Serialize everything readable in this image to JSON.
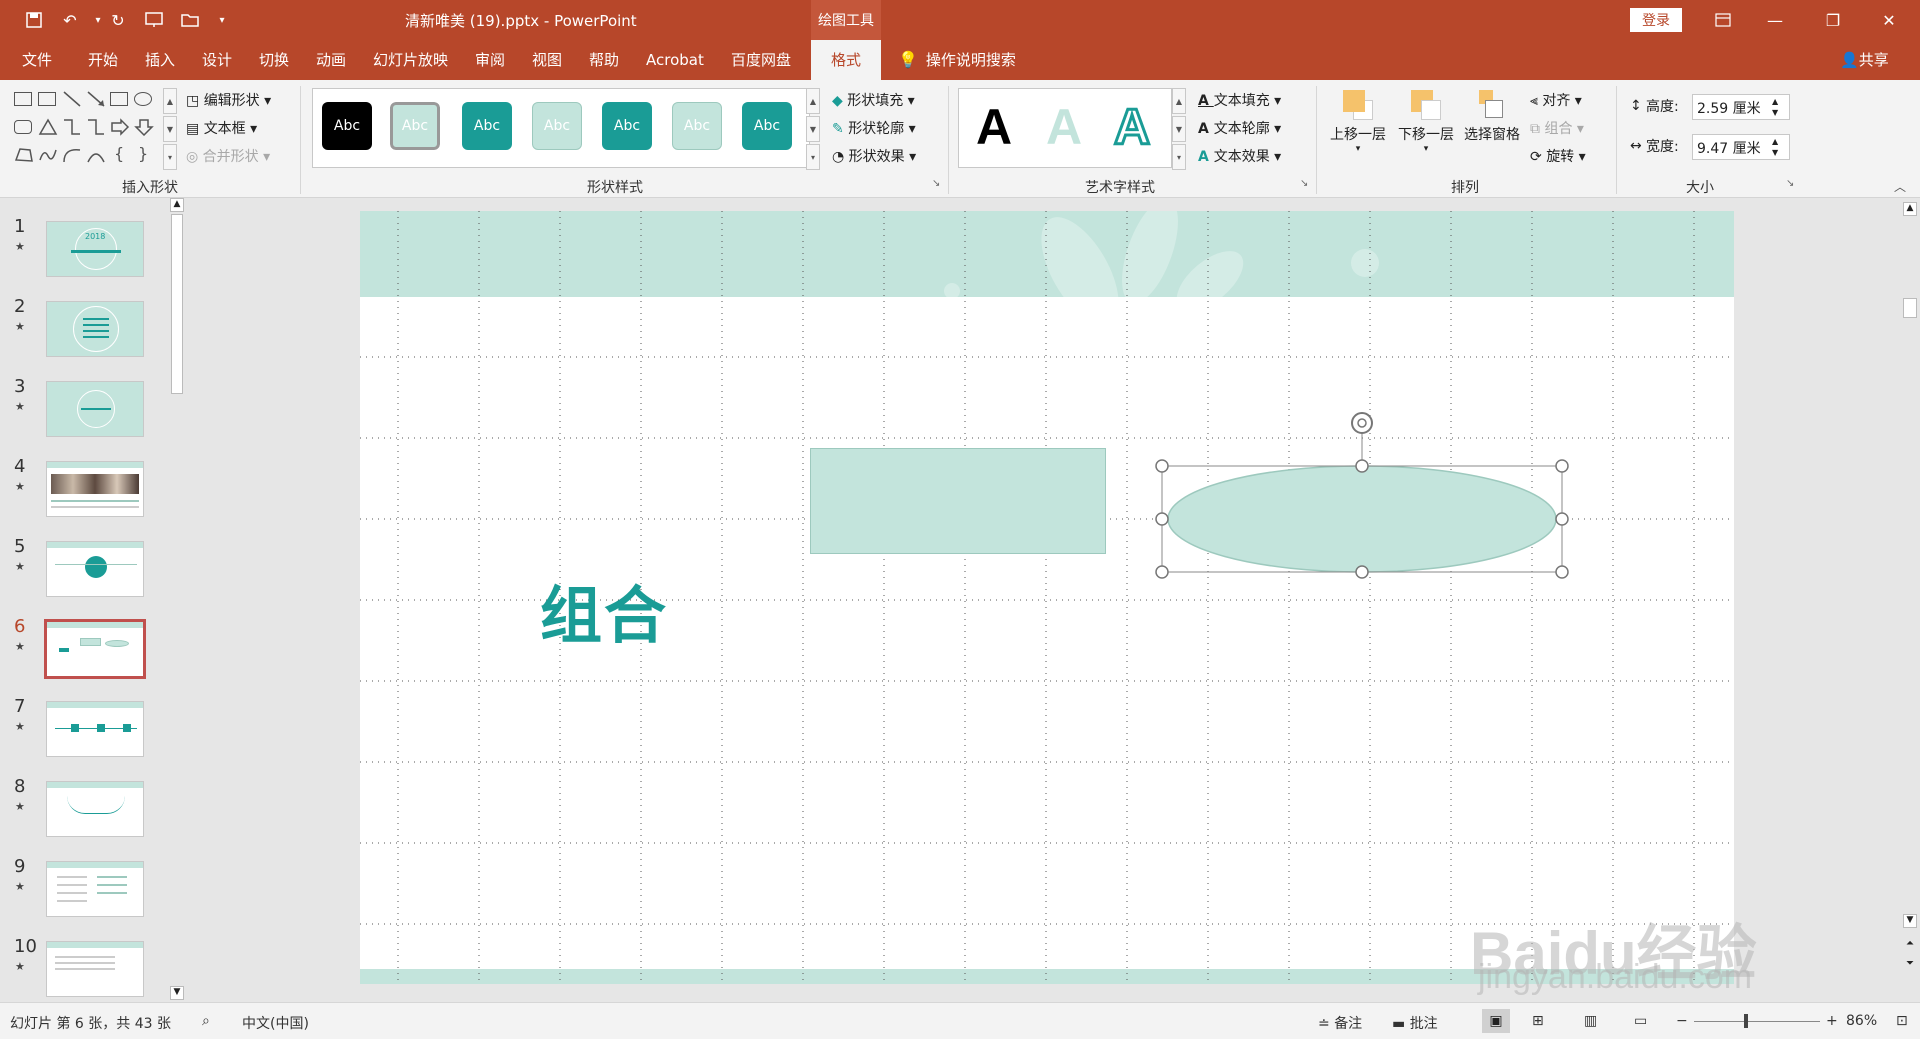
{
  "window": {
    "title": "清新唯美 (19).pptx  -  PowerPoint",
    "context_tab": "绘图工具",
    "login": "登录"
  },
  "menu": {
    "tabs": [
      "文件",
      "开始",
      "插入",
      "设计",
      "切换",
      "动画",
      "幻灯片放映",
      "审阅",
      "视图",
      "帮助",
      "Acrobat",
      "百度网盘",
      "格式"
    ],
    "active_tab": "格式",
    "tell_me": "操作说明搜索",
    "share": "共享"
  },
  "ribbon": {
    "insert_shapes": {
      "label": "插入形状",
      "edit_shape": "编辑形状",
      "text_box": "文本框",
      "merge_shapes": "合并形状"
    },
    "shape_styles": {
      "label": "形状样式",
      "swatches": [
        "Abc",
        "Abc",
        "Abc",
        "Abc",
        "Abc",
        "Abc",
        "Abc"
      ],
      "fill": "形状填充",
      "outline": "形状轮廓",
      "effects": "形状效果"
    },
    "wordart": {
      "label": "艺术字样式",
      "letters": [
        "A",
        "A",
        "A"
      ],
      "text_fill": "文本填充",
      "text_outline": "文本轮廓",
      "text_effects": "文本效果"
    },
    "arrange": {
      "label": "排列",
      "bring_forward": "上移一层",
      "send_backward": "下移一层",
      "selection_pane": "选择窗格",
      "align": "对齐",
      "group": "组合",
      "rotate": "旋转"
    },
    "size": {
      "label": "大小",
      "height_label": "高度:",
      "height_value": "2.59 厘米",
      "width_label": "宽度:",
      "width_value": "9.47 厘米"
    }
  },
  "slides": {
    "numbers": [
      "1",
      "2",
      "3",
      "4",
      "5",
      "6",
      "7",
      "8",
      "9",
      "10"
    ],
    "active": "6",
    "star": "★",
    "thumb1_year": "2018"
  },
  "slide": {
    "title": "组合"
  },
  "status": {
    "slide_info": "幻灯片 第 6 张，共 43 张",
    "language": "中文(中国)",
    "notes": "备注",
    "comments": "批注",
    "zoom": "86%"
  },
  "watermark": {
    "brand": "Baidu经验",
    "url": "jingyan.baidu.com"
  },
  "colors": {
    "brand": "#b7472a",
    "teal": "#1a9c96",
    "mint": "#c3e4dc"
  }
}
